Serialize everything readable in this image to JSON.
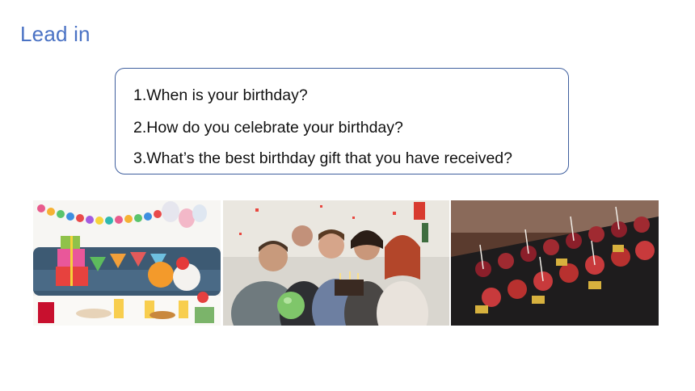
{
  "slide": {
    "title": "Lead in",
    "questions": [
      "1.When is your birthday?",
      "2.How do you celebrate your birthday?",
      "3.What’s the best birthday gift that you have received?"
    ]
  },
  "photos": [
    {
      "name": "party-decorations-photo"
    },
    {
      "name": "friends-celebrating-photo"
    },
    {
      "name": "party-food-photo"
    }
  ]
}
